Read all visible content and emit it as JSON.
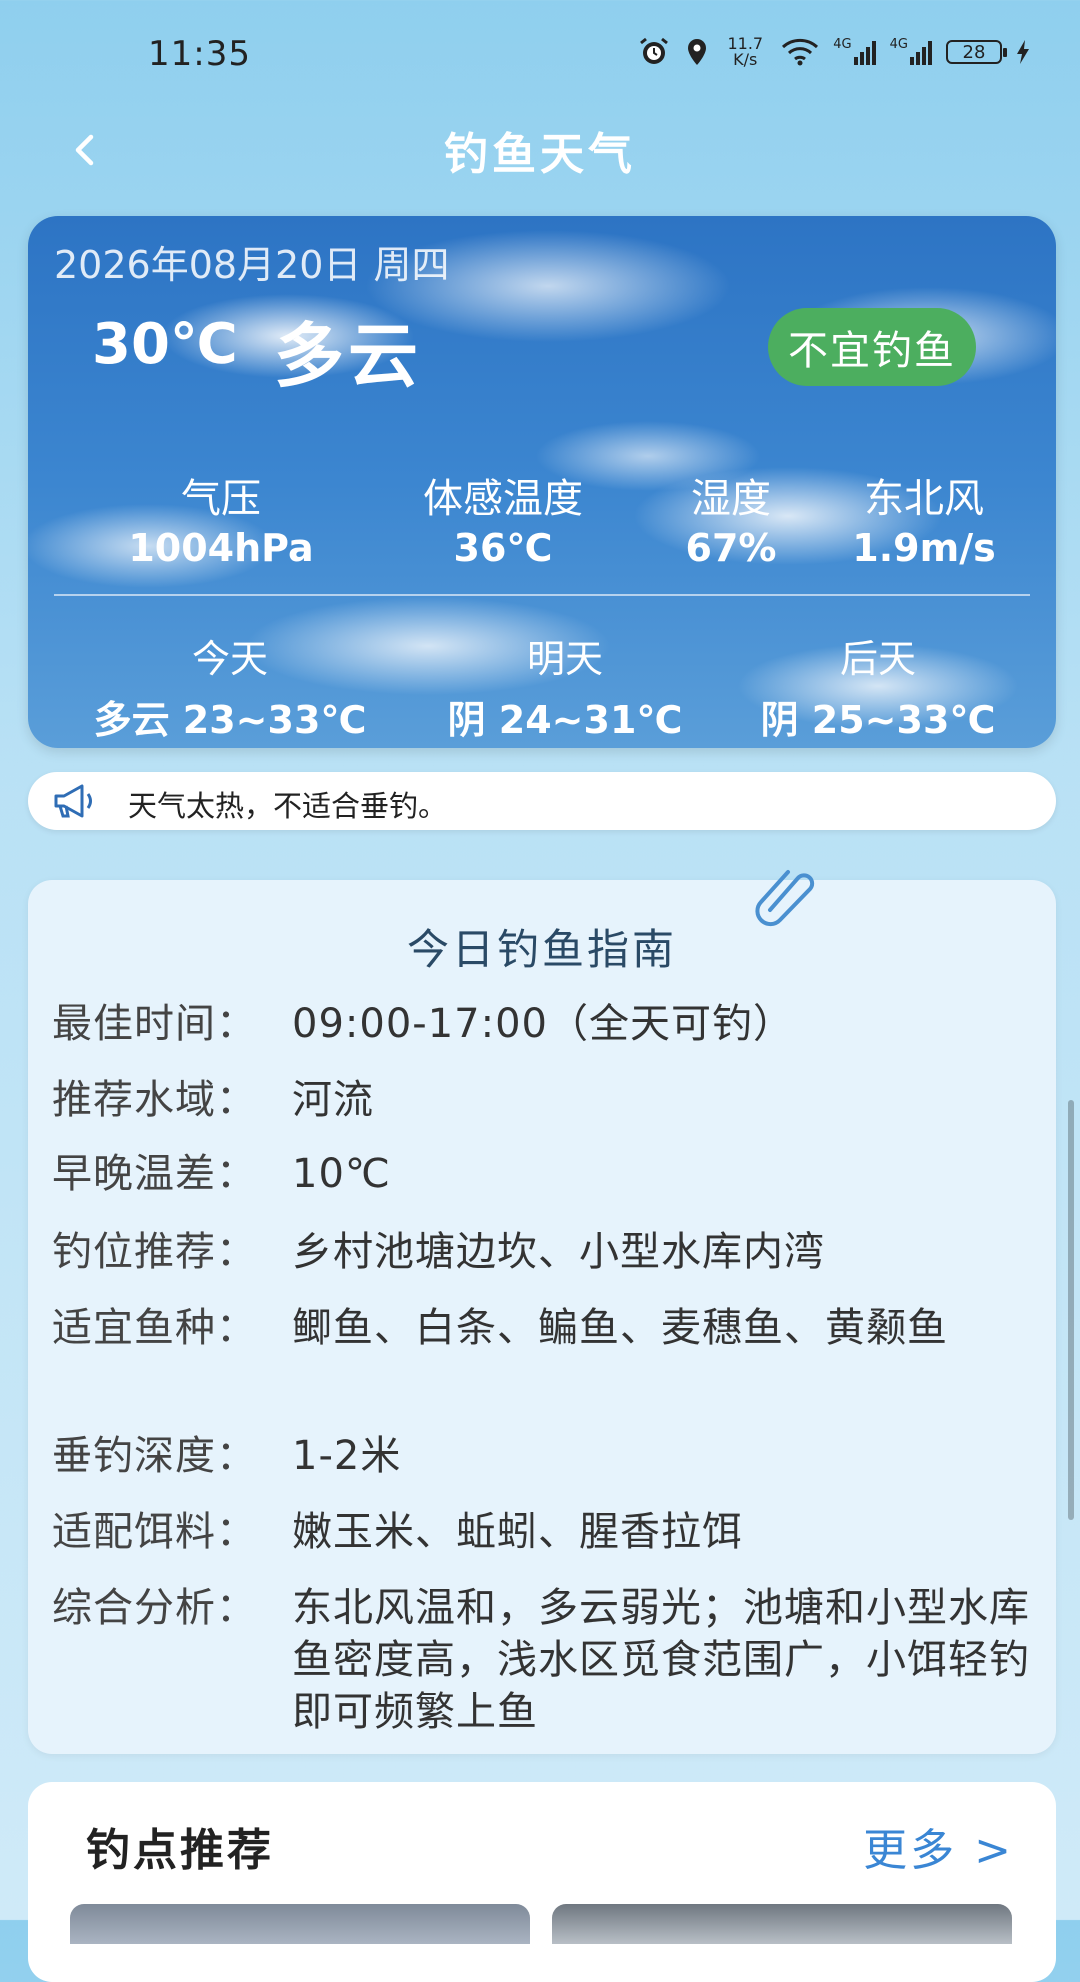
{
  "status_bar": {
    "time": "11:35",
    "net_speed_top": "11.7",
    "net_speed_bottom": "K/s",
    "net_type_1": "4G",
    "net_type_2": "4G",
    "battery": "28",
    "icons": [
      "alarm-icon",
      "location-icon",
      "wifi-icon",
      "signal-icon",
      "signal-icon",
      "battery-icon",
      "charging-icon"
    ]
  },
  "header": {
    "title": "钓鱼天气",
    "back_icon": "chevron-left-icon"
  },
  "weather": {
    "date": "2026年08月20日 周四",
    "temperature": "30℃",
    "condition": "多云",
    "badge": "不宜钓鱼",
    "badge_color": "#4cae5f",
    "metrics": [
      {
        "label": "气压",
        "value": "1004hPa"
      },
      {
        "label": "体感温度",
        "value": "36℃"
      },
      {
        "label": "湿度",
        "value": "67%"
      },
      {
        "label": "东北风",
        "value": "1.9m/s"
      }
    ],
    "forecast": [
      {
        "day": "今天",
        "range": "多云 23~33℃"
      },
      {
        "day": "明天",
        "range": "阴 24~31℃"
      },
      {
        "day": "后天",
        "range": "阴 25~33℃"
      }
    ]
  },
  "notice": {
    "icon": "megaphone-icon",
    "text": "天气太热，不适合垂钓。"
  },
  "guide": {
    "title": "今日钓鱼指南",
    "rows": [
      {
        "label": "最佳时间：",
        "value": "09:00-17:00（全天可钓）"
      },
      {
        "label": "推荐水域：",
        "value": "河流"
      },
      {
        "label": "早晚温差：",
        "value": "10℃"
      },
      {
        "label": "钓位推荐：",
        "value": "乡村池塘边坎、小型水库内湾"
      },
      {
        "label": "适宜鱼种：",
        "value": "鲫鱼、白条、鳊鱼、麦穗鱼、黄颡鱼"
      },
      {
        "label": "垂钓深度：",
        "value": "1-2米"
      },
      {
        "label": "适配饵料：",
        "value": "嫩玉米、蚯蚓、腥香拉饵"
      },
      {
        "label": "综合分析：",
        "value": "东北风温和，多云弱光；池塘和小型水库鱼密度高，浅水区觅食范围广，小饵轻钓即可频繁上鱼"
      }
    ]
  },
  "spots": {
    "title": "钓点推荐",
    "more": "更多 >",
    "more_color": "#3a86d4"
  }
}
